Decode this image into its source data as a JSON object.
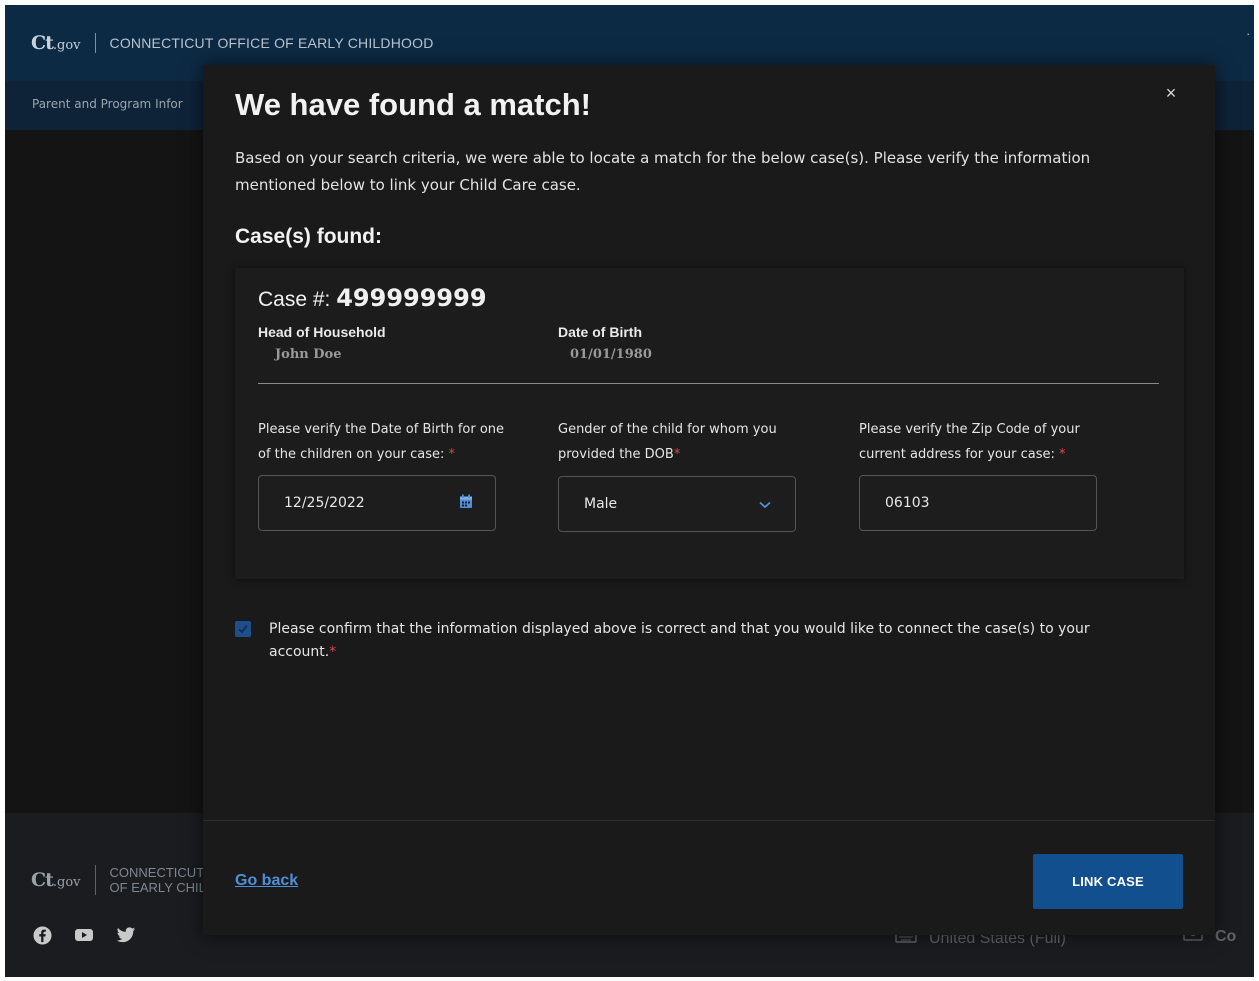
{
  "header": {
    "logo_main": "Ct",
    "logo_suffix": ".gov",
    "agency": "CONNECTICUT OFFICE OF EARLY CHILDHOOD",
    "right_fragment": "."
  },
  "subnav": {
    "text": "Parent and Program Infor"
  },
  "footer": {
    "logo_main": "Ct",
    "logo_suffix": ".gov",
    "agency_line1": "CONNECTICUT",
    "agency_line2": "OF EARLY CHIL",
    "language": "United States (Full)",
    "contact": "Co",
    "social": [
      "facebook-icon",
      "youtube-icon",
      "twitter-icon"
    ]
  },
  "modal": {
    "title": "We have found a match!",
    "description": "Based on your search criteria, we were able to locate a match for the below case(s). Please verify the information mentioned below to link your Child Care case.",
    "cases_found_label": "Case(s) found:",
    "case": {
      "number_label": "Case #:",
      "number": "499999999",
      "head_label": "Head of Household",
      "head_value": "John Doe",
      "dob_label": "Date of Birth",
      "dob_value": "01/01/1980"
    },
    "questions": {
      "child_dob_label": "Please verify the Date of Birth for one of the children on your case:",
      "child_dob_value": "12/25/2022",
      "gender_label": "Gender of the child for whom you provided the DOB",
      "gender_value": "Male",
      "zip_label": "Please verify the Zip Code of your current address for your case:",
      "zip_value": "06103",
      "required_mark": "*"
    },
    "confirm_text": "Please confirm that the information displayed above is correct and that you would like to connect the case(s) to your account.",
    "go_back_label": "Go back",
    "link_case_label": "LINK CASE",
    "close_symbol": "×"
  },
  "colors": {
    "primary_button": "#124f8f",
    "link": "#4f8fd8",
    "required": "#d8484f",
    "header_bg": "#0d2a44"
  }
}
